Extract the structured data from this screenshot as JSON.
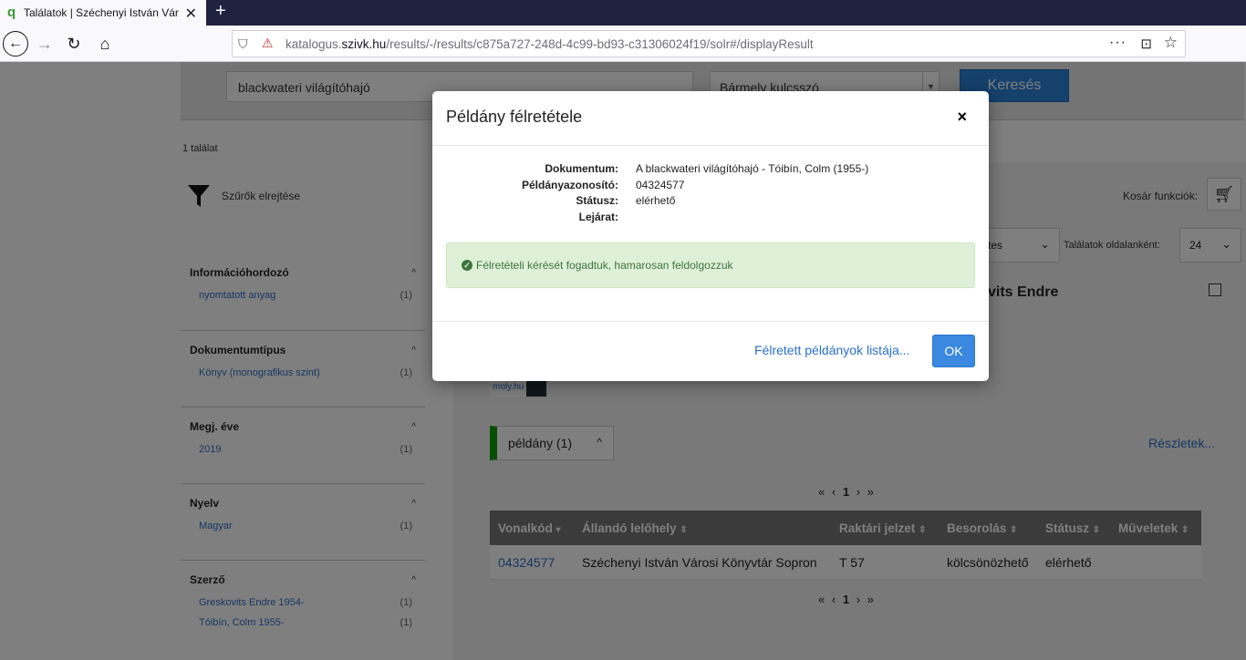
{
  "browser": {
    "tab_title": "Találatok | Széchenyi István Vár",
    "new_tab": "+",
    "url_prefix": "katalogus.",
    "url_domain": "szivk.hu",
    "url_path": "/results/-/results/c875a727-248d-4c99-bd93-c31306024f19/solr#/displayResult"
  },
  "search": {
    "query": "blackwateri világítóhajó",
    "field": "Bármely kulcsszó",
    "button": "Keresés"
  },
  "hit_count": "1 találat",
  "filter_toggle": "Szűrők elrejtése",
  "facets": [
    {
      "title": "Információhordozó",
      "items": [
        {
          "label": "nyomtatott anyag",
          "count": "(1)"
        }
      ]
    },
    {
      "title": "Dokumentumtípus",
      "items": [
        {
          "label": "Könyv (monografikus szint)",
          "count": "(1)"
        }
      ]
    },
    {
      "title": "Megj. éve",
      "items": [
        {
          "label": "2019",
          "count": "(1)"
        }
      ]
    },
    {
      "title": "Nyelv",
      "items": [
        {
          "label": "Magyar",
          "count": "(1)"
        }
      ]
    },
    {
      "title": "Szerző",
      "items": [
        {
          "label": "Greskovits Endre 1954-",
          "count": "(1)"
        },
        {
          "label": "Tóibín, Colm 1955-",
          "count": "(1)"
        }
      ]
    }
  ],
  "results": {
    "cart_label": "Kosár funkciók:",
    "sort_value": "tes",
    "per_page_label": "Találatok oldalanként:",
    "per_page_value": "24",
    "author_fragment": "vits Endre",
    "moly": "moly.hu",
    "copies_button": "példány (1)",
    "details_link": "Részletek...",
    "pager_current": "1",
    "table": {
      "headers": [
        "Vonalkód",
        "Állandó lelőhely",
        "Raktári jelzet",
        "Besorolás",
        "Státusz",
        "Műveletek"
      ],
      "rows": [
        [
          "04324577",
          "Széchenyi István Városi Könyvtár Sopron",
          "T 57",
          "kölcsönözhető",
          "elérhető",
          ""
        ]
      ]
    }
  },
  "modal": {
    "title": "Példány félretétele",
    "close": "×",
    "fields": [
      {
        "key": "Dokumentum:",
        "value": "A blackwateri világítóhajó - Tóibín, Colm (1955-)"
      },
      {
        "key": "Példányazonosító:",
        "value": "04324577"
      },
      {
        "key": "Státusz:",
        "value": "elérhető"
      },
      {
        "key": "Lejárat:",
        "value": ""
      }
    ],
    "alert": "Félretételi kérését fogadtuk, hamarosan feldolgozzuk",
    "reserved_list_link": "Félretett példányok listája...",
    "ok_button": "OK"
  }
}
